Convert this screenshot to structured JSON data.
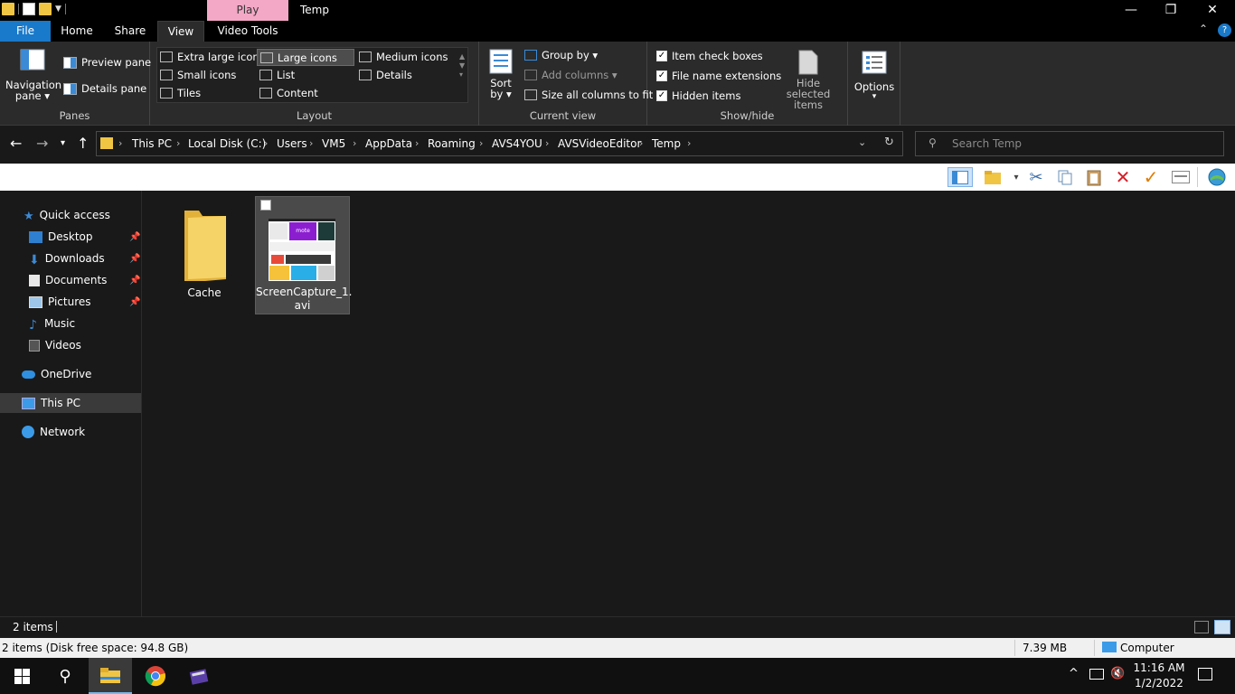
{
  "window": {
    "title": "Temp",
    "context_tab": "Play",
    "minimize": "—",
    "maximize": "❐",
    "close": "✕"
  },
  "tabs": {
    "file": "File",
    "home": "Home",
    "share": "Share",
    "view": "View",
    "video_tools": "Video Tools"
  },
  "ribbon": {
    "panes": {
      "label": "Panes",
      "navigation_pane_1": "Navigation",
      "navigation_pane_2": "pane ▾",
      "preview_pane": "Preview pane",
      "details_pane": "Details pane"
    },
    "layout": {
      "label": "Layout",
      "extra_large_icons": "Extra large icons",
      "large_icons": "Large icons",
      "medium_icons": "Medium icons",
      "small_icons": "Small icons",
      "list": "List",
      "details": "Details",
      "tiles": "Tiles",
      "content": "Content"
    },
    "current_view": {
      "label": "Current view",
      "sort_by_1": "Sort",
      "sort_by_2": "by ▾",
      "group_by": "Group by ▾",
      "add_columns": "Add columns ▾",
      "size_columns": "Size all columns to fit"
    },
    "show_hide": {
      "label": "Show/hide",
      "item_check_boxes": "Item check boxes",
      "file_name_extensions": "File name extensions",
      "hidden_items": "Hidden items",
      "hide_selected_1": "Hide selected",
      "hide_selected_2": "items"
    },
    "options": {
      "label": "Options",
      "arrow": "▾"
    }
  },
  "address": {
    "crumbs": [
      "This PC",
      "Local Disk (C:)",
      "Users",
      "VM5",
      "AppData",
      "Roaming",
      "AVS4YOU",
      "AVSVideoEditor",
      "Temp"
    ],
    "search_placeholder": "Search Temp"
  },
  "sidebar": {
    "quick_access": "Quick access",
    "desktop": "Desktop",
    "downloads": "Downloads",
    "documents": "Documents",
    "pictures": "Pictures",
    "music": "Music",
    "videos": "Videos",
    "onedrive": "OneDrive",
    "this_pc": "This PC",
    "network": "Network"
  },
  "files": [
    {
      "name": "Cache",
      "type": "folder"
    },
    {
      "name": "ScreenCapture_1.",
      "name2": "avi",
      "type": "video",
      "thumb_text": "mote"
    }
  ],
  "status": {
    "count": "2 items",
    "detail": "2 items (Disk free space: 94.8 GB)",
    "size": "7.39 MB",
    "location": "Computer"
  },
  "taskbar": {
    "time": "11:16 AM",
    "date": "1/2/2022"
  },
  "colors": {
    "file_tab": "#1979ca",
    "context_tab": "#f3a8c6",
    "folder": "#f0c544",
    "accent": "#76b9ed"
  }
}
